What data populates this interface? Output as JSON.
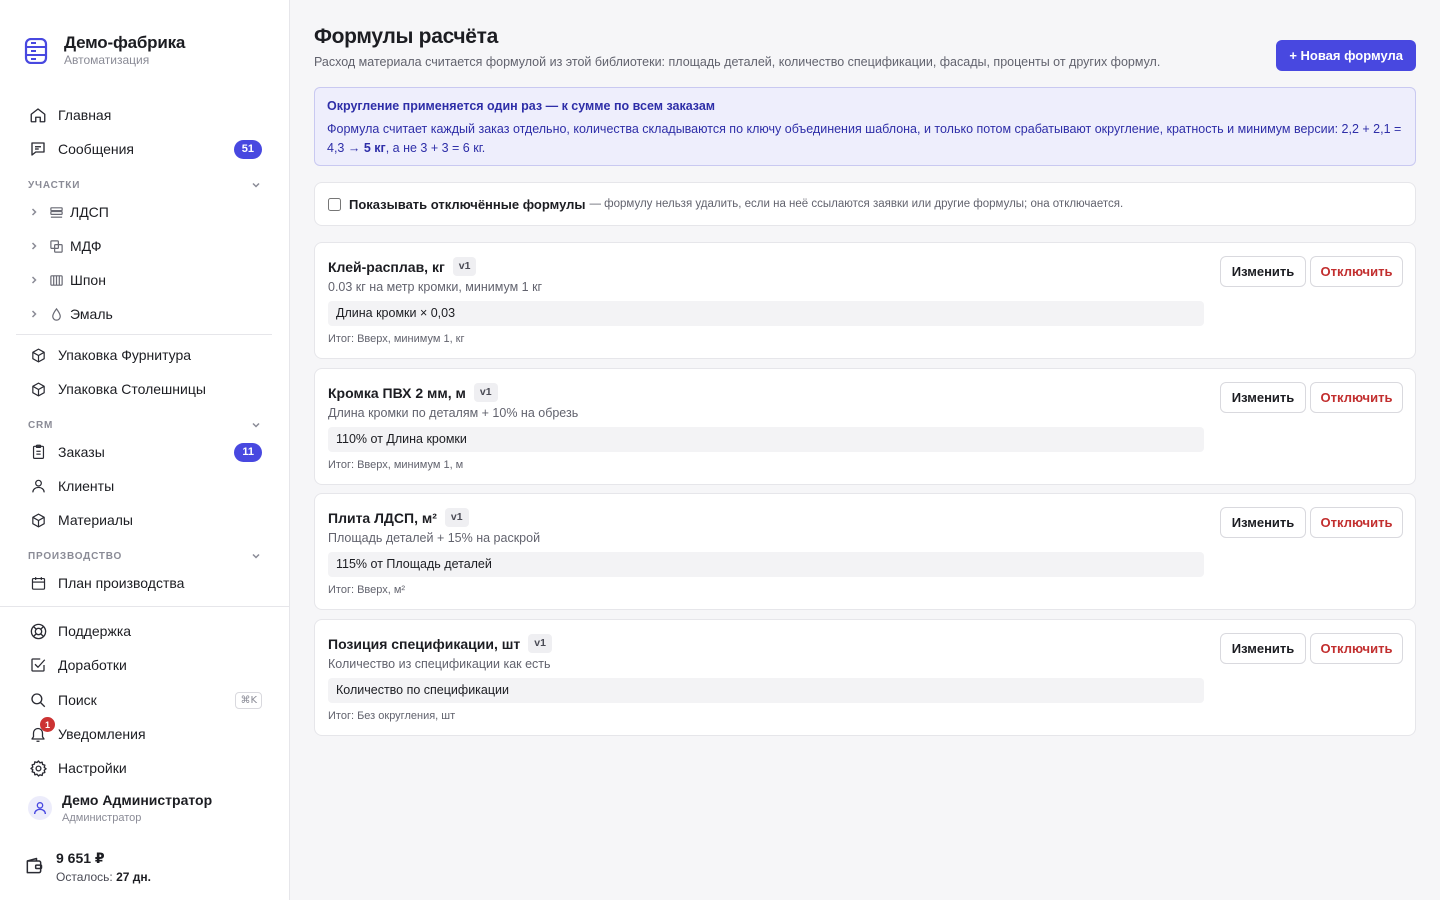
{
  "brand": {
    "name": "Демо-фабрика",
    "subtitle": "Автоматизация",
    "icon": "server-stack-icon"
  },
  "sidebar": {
    "top": [
      {
        "label": "Главная",
        "icon": "home-icon"
      },
      {
        "label": "Сообщения",
        "icon": "message-icon",
        "badge": "51"
      }
    ],
    "sections": {
      "workshops": "УЧАСТКИ",
      "crm": "CRM",
      "production": "ПРОИЗВОДСТВО"
    },
    "workshops": [
      {
        "label": "ЛДСП",
        "icon": "layers-icon"
      },
      {
        "label": "МДФ",
        "icon": "copy-icon"
      },
      {
        "label": "Шпон",
        "icon": "veneer-icon"
      },
      {
        "label": "Эмаль",
        "icon": "drop-icon"
      }
    ],
    "packaging": [
      {
        "label": "Упаковка Фурнитура",
        "icon": "box-icon"
      },
      {
        "label": "Упаковка Столешницы",
        "icon": "box-icon"
      }
    ],
    "crm": [
      {
        "label": "Заказы",
        "icon": "clipboard-icon",
        "badge": "11"
      },
      {
        "label": "Клиенты",
        "icon": "user-icon"
      },
      {
        "label": "Материалы",
        "icon": "box-icon"
      }
    ],
    "production": [
      {
        "label": "План производства",
        "icon": "calendar-icon"
      }
    ],
    "bottom": [
      {
        "label": "Поддержка",
        "icon": "lifebuoy-icon"
      },
      {
        "label": "Доработки",
        "icon": "check-square-icon"
      },
      {
        "label": "Поиск",
        "icon": "search-icon",
        "shortcut": "⌘K"
      },
      {
        "label": "Уведомления",
        "icon": "bell-icon",
        "count": "1"
      },
      {
        "label": "Настройки",
        "icon": "gear-icon"
      }
    ],
    "user": {
      "name": "Демо Администратор",
      "role": "Администратор"
    },
    "wallet": {
      "amount": "9 651 ₽",
      "left_label": "Осталось:",
      "left_value": "27 дн."
    }
  },
  "header": {
    "title": "Формулы расчёта",
    "subtitle": "Расход материала считается формулой из этой библиотеки: площадь деталей, количество спецификации, фасады, проценты от других формул.",
    "new_button": "+ Новая формула"
  },
  "info": {
    "title": "Округление применяется один раз — к сумме по всем заказам",
    "body_start": "Формула считает каждый заказ отдельно, количества складываются по ключу объединения шаблона, и только потом срабатывают округление, кратность и минимум версии: 2,2 + 2,1 = 4,3 → ",
    "body_bold": "5 кг",
    "body_end": ", а не 3 + 3 = 6 кг."
  },
  "toggle": {
    "label": "Показывать отключённые формулы",
    "note": "— формулу нельзя удалить, если на неё ссылаются заявки или другие формулы; она отключается.",
    "checked": false
  },
  "actions": {
    "edit": "Изменить",
    "disable": "Отключить"
  },
  "formulas": [
    {
      "name": "Клей-расплав, кг",
      "version": "v1",
      "description": "0.03 кг на метр кромки, минимум 1 кг",
      "expression": "Длина кромки × 0,03",
      "result": "Итог: Вверх, минимум 1, кг"
    },
    {
      "name": "Кромка ПВХ 2 мм, м",
      "version": "v1",
      "description": "Длина кромки по деталям + 10% на обрезь",
      "expression": "110% от Длина кромки",
      "result": "Итог: Вверх, минимум 1, м"
    },
    {
      "name": "Плита ЛДСП, м²",
      "version": "v1",
      "description": "Площадь деталей + 15% на раскрой",
      "expression": "115% от Площадь деталей",
      "result": "Итог: Вверх, м²"
    },
    {
      "name": "Позиция спецификации, шт",
      "version": "v1",
      "description": "Количество из спецификации как есть",
      "expression": "Количество по спецификации",
      "result": "Итог: Без округления, шт"
    }
  ],
  "colors": {
    "accent": "#4848e0",
    "danger": "#c22f2f",
    "info_bg": "#eeeefc",
    "info_text": "#2e2ea8"
  }
}
